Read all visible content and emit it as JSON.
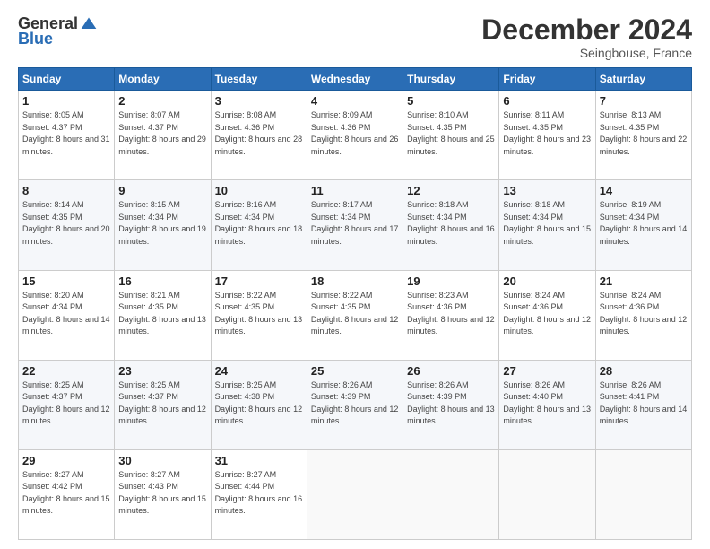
{
  "logo": {
    "general": "General",
    "blue": "Blue"
  },
  "title": "December 2024",
  "subtitle": "Seingbouse, France",
  "days_header": [
    "Sunday",
    "Monday",
    "Tuesday",
    "Wednesday",
    "Thursday",
    "Friday",
    "Saturday"
  ],
  "weeks": [
    [
      {
        "day": "1",
        "sunrise": "Sunrise: 8:05 AM",
        "sunset": "Sunset: 4:37 PM",
        "daylight": "Daylight: 8 hours and 31 minutes."
      },
      {
        "day": "2",
        "sunrise": "Sunrise: 8:07 AM",
        "sunset": "Sunset: 4:37 PM",
        "daylight": "Daylight: 8 hours and 29 minutes."
      },
      {
        "day": "3",
        "sunrise": "Sunrise: 8:08 AM",
        "sunset": "Sunset: 4:36 PM",
        "daylight": "Daylight: 8 hours and 28 minutes."
      },
      {
        "day": "4",
        "sunrise": "Sunrise: 8:09 AM",
        "sunset": "Sunset: 4:36 PM",
        "daylight": "Daylight: 8 hours and 26 minutes."
      },
      {
        "day": "5",
        "sunrise": "Sunrise: 8:10 AM",
        "sunset": "Sunset: 4:35 PM",
        "daylight": "Daylight: 8 hours and 25 minutes."
      },
      {
        "day": "6",
        "sunrise": "Sunrise: 8:11 AM",
        "sunset": "Sunset: 4:35 PM",
        "daylight": "Daylight: 8 hours and 23 minutes."
      },
      {
        "day": "7",
        "sunrise": "Sunrise: 8:13 AM",
        "sunset": "Sunset: 4:35 PM",
        "daylight": "Daylight: 8 hours and 22 minutes."
      }
    ],
    [
      {
        "day": "8",
        "sunrise": "Sunrise: 8:14 AM",
        "sunset": "Sunset: 4:35 PM",
        "daylight": "Daylight: 8 hours and 20 minutes."
      },
      {
        "day": "9",
        "sunrise": "Sunrise: 8:15 AM",
        "sunset": "Sunset: 4:34 PM",
        "daylight": "Daylight: 8 hours and 19 minutes."
      },
      {
        "day": "10",
        "sunrise": "Sunrise: 8:16 AM",
        "sunset": "Sunset: 4:34 PM",
        "daylight": "Daylight: 8 hours and 18 minutes."
      },
      {
        "day": "11",
        "sunrise": "Sunrise: 8:17 AM",
        "sunset": "Sunset: 4:34 PM",
        "daylight": "Daylight: 8 hours and 17 minutes."
      },
      {
        "day": "12",
        "sunrise": "Sunrise: 8:18 AM",
        "sunset": "Sunset: 4:34 PM",
        "daylight": "Daylight: 8 hours and 16 minutes."
      },
      {
        "day": "13",
        "sunrise": "Sunrise: 8:18 AM",
        "sunset": "Sunset: 4:34 PM",
        "daylight": "Daylight: 8 hours and 15 minutes."
      },
      {
        "day": "14",
        "sunrise": "Sunrise: 8:19 AM",
        "sunset": "Sunset: 4:34 PM",
        "daylight": "Daylight: 8 hours and 14 minutes."
      }
    ],
    [
      {
        "day": "15",
        "sunrise": "Sunrise: 8:20 AM",
        "sunset": "Sunset: 4:34 PM",
        "daylight": "Daylight: 8 hours and 14 minutes."
      },
      {
        "day": "16",
        "sunrise": "Sunrise: 8:21 AM",
        "sunset": "Sunset: 4:35 PM",
        "daylight": "Daylight: 8 hours and 13 minutes."
      },
      {
        "day": "17",
        "sunrise": "Sunrise: 8:22 AM",
        "sunset": "Sunset: 4:35 PM",
        "daylight": "Daylight: 8 hours and 13 minutes."
      },
      {
        "day": "18",
        "sunrise": "Sunrise: 8:22 AM",
        "sunset": "Sunset: 4:35 PM",
        "daylight": "Daylight: 8 hours and 12 minutes."
      },
      {
        "day": "19",
        "sunrise": "Sunrise: 8:23 AM",
        "sunset": "Sunset: 4:36 PM",
        "daylight": "Daylight: 8 hours and 12 minutes."
      },
      {
        "day": "20",
        "sunrise": "Sunrise: 8:24 AM",
        "sunset": "Sunset: 4:36 PM",
        "daylight": "Daylight: 8 hours and 12 minutes."
      },
      {
        "day": "21",
        "sunrise": "Sunrise: 8:24 AM",
        "sunset": "Sunset: 4:36 PM",
        "daylight": "Daylight: 8 hours and 12 minutes."
      }
    ],
    [
      {
        "day": "22",
        "sunrise": "Sunrise: 8:25 AM",
        "sunset": "Sunset: 4:37 PM",
        "daylight": "Daylight: 8 hours and 12 minutes."
      },
      {
        "day": "23",
        "sunrise": "Sunrise: 8:25 AM",
        "sunset": "Sunset: 4:37 PM",
        "daylight": "Daylight: 8 hours and 12 minutes."
      },
      {
        "day": "24",
        "sunrise": "Sunrise: 8:25 AM",
        "sunset": "Sunset: 4:38 PM",
        "daylight": "Daylight: 8 hours and 12 minutes."
      },
      {
        "day": "25",
        "sunrise": "Sunrise: 8:26 AM",
        "sunset": "Sunset: 4:39 PM",
        "daylight": "Daylight: 8 hours and 12 minutes."
      },
      {
        "day": "26",
        "sunrise": "Sunrise: 8:26 AM",
        "sunset": "Sunset: 4:39 PM",
        "daylight": "Daylight: 8 hours and 13 minutes."
      },
      {
        "day": "27",
        "sunrise": "Sunrise: 8:26 AM",
        "sunset": "Sunset: 4:40 PM",
        "daylight": "Daylight: 8 hours and 13 minutes."
      },
      {
        "day": "28",
        "sunrise": "Sunrise: 8:26 AM",
        "sunset": "Sunset: 4:41 PM",
        "daylight": "Daylight: 8 hours and 14 minutes."
      }
    ],
    [
      {
        "day": "29",
        "sunrise": "Sunrise: 8:27 AM",
        "sunset": "Sunset: 4:42 PM",
        "daylight": "Daylight: 8 hours and 15 minutes."
      },
      {
        "day": "30",
        "sunrise": "Sunrise: 8:27 AM",
        "sunset": "Sunset: 4:43 PM",
        "daylight": "Daylight: 8 hours and 15 minutes."
      },
      {
        "day": "31",
        "sunrise": "Sunrise: 8:27 AM",
        "sunset": "Sunset: 4:44 PM",
        "daylight": "Daylight: 8 hours and 16 minutes."
      },
      null,
      null,
      null,
      null
    ]
  ]
}
